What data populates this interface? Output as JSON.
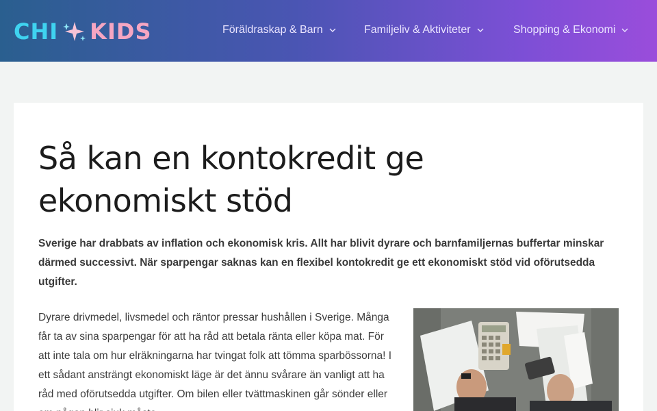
{
  "header": {
    "logo": {
      "left_word": "CHI",
      "right_word": "KIDS"
    },
    "nav": [
      {
        "label": "Föräldraskap & Barn"
      },
      {
        "label": "Familjeliv & Aktiviteter"
      },
      {
        "label": "Shopping & Ekonomi"
      }
    ]
  },
  "article": {
    "title": "Så kan en kontokredit ge ekonomiskt stöd",
    "lead": "Sverige har drabbats av inflation och ekonomisk kris. Allt har blivit dyrare och barnfamiljernas buffertar minskar därmed successivt. När sparpengar saknas kan en flexibel kontokredit ge ett ekonomiskt stöd vid oförutsedda utgifter.",
    "paragraph": "Dyrare drivmedel, livsmedel och räntor pressar hushållen i Sverige. Många får ta av sina sparpengar för att ha råd att betala ränta eller köpa mat. För att inte tala om hur elräkningarna har tvingat folk att tömma sparbössorna! I ett sådant ansträngt ekonomiskt läge är det ännu svårare än vanligt att ha råd med oförutsedda utgifter. Om bilen eller tvättmaskinen går sönder eller om någon blir sjuk måste",
    "image": {
      "icon": "calculator-bills-photo"
    }
  },
  "colors": {
    "header_start": "#2a5f8f",
    "header_end": "#9a4ddb",
    "logo_chi": "#3fd3f0",
    "logo_kids": "#f6a6c2",
    "page_bg": "#f2f4f3"
  }
}
